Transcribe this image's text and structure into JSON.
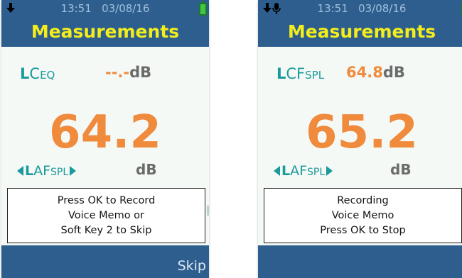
{
  "screens": [
    {
      "time": "13:51",
      "date": "03/08/16",
      "title": "Measurements",
      "param_big": "L",
      "param_rest": "C",
      "param_sub": "EQ",
      "param_value": "--.-",
      "param_unit": "dB",
      "reading": "64.2",
      "weight_big": "L",
      "weight_rest": "AF",
      "weight_sub": "SPL",
      "weight_unit": "dB",
      "dialog_lines": [
        "Press OK to Record",
        "Voice Memo or",
        "Soft Key 2 to Skip"
      ],
      "softkey": "Skip"
    },
    {
      "time": "13:51",
      "date": "03/08/16",
      "title": "Measurements",
      "param_big": "L",
      "param_rest": "CF",
      "param_sub": "SPL",
      "param_value": "64.8",
      "param_unit": "dB",
      "reading": "65.2",
      "weight_big": "L",
      "weight_rest": "AF",
      "weight_sub": "SPL",
      "weight_unit": "dB",
      "dialog_lines": [
        "Recording",
        "Voice Memo",
        "Press OK to Stop"
      ]
    }
  ],
  "icons": {
    "left_screen": [
      "download-arrow-icon",
      "battery-full-icon"
    ],
    "right_screen": [
      "download-arrow-icon",
      "microphone-icon",
      "battery-full-icon"
    ]
  },
  "colors": {
    "header": "#2d5e8e",
    "title": "#f3ed1c",
    "teal": "#1a9a9a",
    "orange": "#f08a3c",
    "battery": "#43c743"
  }
}
